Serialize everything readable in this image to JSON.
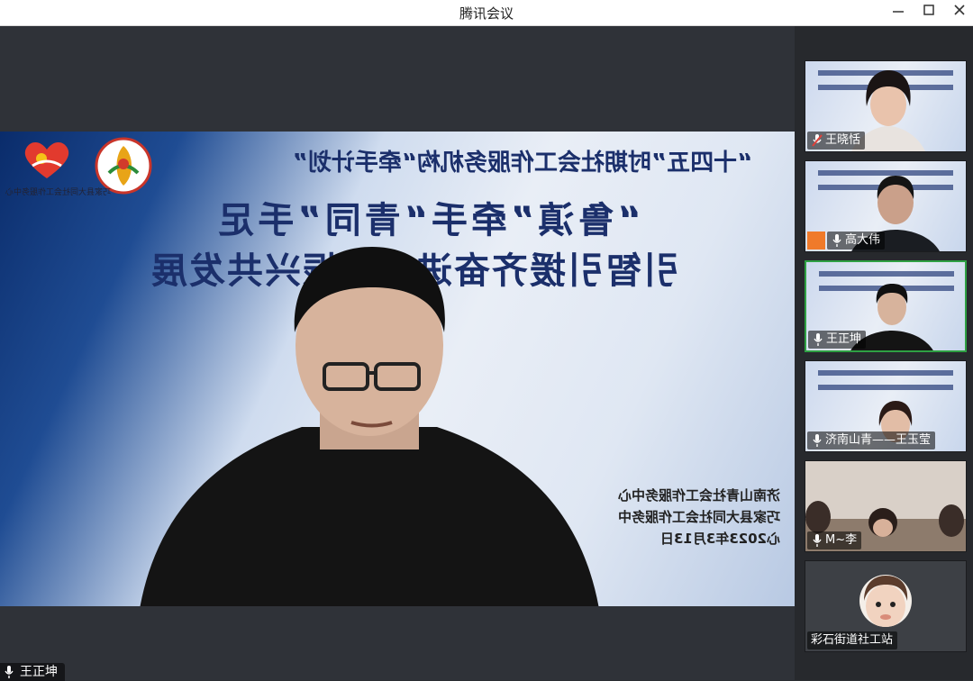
{
  "window": {
    "title": "腾讯会议"
  },
  "main": {
    "banner": {
      "subtitle": "“十四五”时期社会工作服务机构“牵手计划”",
      "line1": "“鲁滇”牵手“青同”手足",
      "line2": "引智引援齐奋进乡村振兴共发展",
      "logo_caption": "巧家县大同社会工作服务中心"
    },
    "info": {
      "org1": "济南山青社会工作服务中心",
      "org2": "巧家县大同社会工作服务中",
      "date": "心2023年3月13日"
    },
    "speaker_name": "王正坤"
  },
  "participants": [
    {
      "name": "王晓恬",
      "mic": "muted"
    },
    {
      "name": "高大伟",
      "mic": "on",
      "avatar": true
    },
    {
      "name": "王正坤",
      "mic": "on",
      "active": true
    },
    {
      "name": "济南山青——王玉莹",
      "mic": "on"
    },
    {
      "name": "M~李",
      "mic": "on"
    },
    {
      "name": "彩石街道社工站",
      "mic": "none"
    }
  ],
  "colors": {
    "active_border": "#2ea043",
    "banner_text": "#1b2f6b"
  }
}
